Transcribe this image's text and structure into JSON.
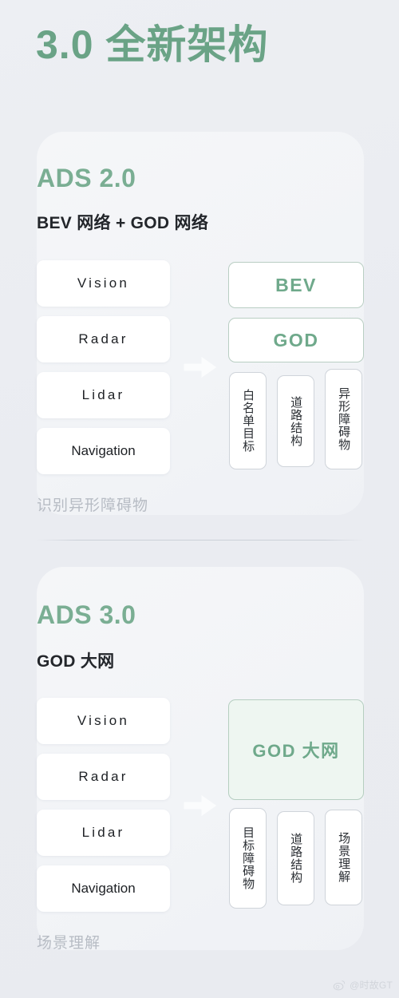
{
  "page": {
    "headline": "3.0 全新架构",
    "background_color": "#eceef2",
    "accent_color": "#6aa386"
  },
  "sections": [
    {
      "id": "ads2",
      "title": "ADS 2.0",
      "subtitle": "BEV 网络 + GOD 网络",
      "inputs": [
        {
          "label": "Vision"
        },
        {
          "label": "Radar"
        },
        {
          "label": "Lidar"
        },
        {
          "label": "Navigation"
        }
      ],
      "outputs": [
        {
          "label": "BEV",
          "style": "outline"
        },
        {
          "label": "GOD",
          "style": "outline"
        }
      ],
      "chips": [
        {
          "label": "白名单目标"
        },
        {
          "label": "道路结构"
        },
        {
          "label": "异形障碍物"
        }
      ],
      "caption": "识别异形障碍物",
      "arrow_icon": "arrow-right-icon"
    },
    {
      "id": "ads3",
      "title": "ADS 3.0",
      "subtitle": "GOD 大网",
      "inputs": [
        {
          "label": "Vision"
        },
        {
          "label": "Radar"
        },
        {
          "label": "Lidar"
        },
        {
          "label": "Navigation"
        }
      ],
      "outputs": [
        {
          "label": "GOD 大网",
          "style": "filled"
        }
      ],
      "chips": [
        {
          "label": "目标障碍物"
        },
        {
          "label": "道路结构"
        },
        {
          "label": "场景理解"
        }
      ],
      "caption": "场景理解",
      "arrow_icon": "arrow-right-icon"
    }
  ],
  "watermark": {
    "icon": "weibo-logo-icon",
    "handle": "@时故GT"
  }
}
